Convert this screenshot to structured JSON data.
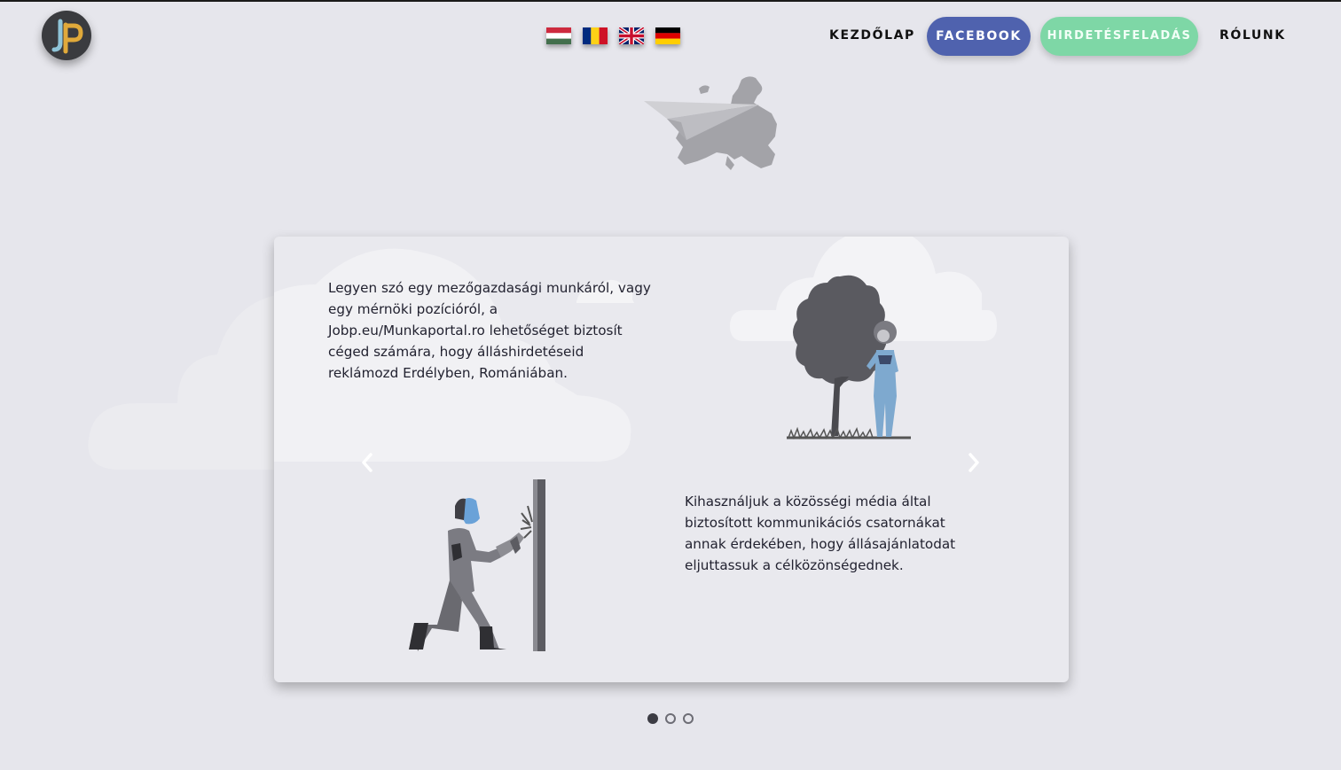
{
  "logo": {
    "letters": "JP",
    "icon": "jp-logo-icon"
  },
  "languages": [
    {
      "code": "hu",
      "icon": "flag-hungary-icon"
    },
    {
      "code": "ro",
      "icon": "flag-romania-icon"
    },
    {
      "code": "en",
      "icon": "flag-uk-icon"
    },
    {
      "code": "de",
      "icon": "flag-germany-icon"
    }
  ],
  "nav": {
    "home": "KEZDŐLAP",
    "facebook": "FACEBOOK",
    "post_ad": "HIRDETÉSFELADÁS",
    "about": "RÓLUNK"
  },
  "colors": {
    "facebook": "#4f62ae",
    "post_ad": "#7ed7a6",
    "background": "#e6e6ec"
  },
  "slider": {
    "text_top": "Legyen szó egy mezőgazdasági munkáról, vagy egy mérnöki pozícióról, a Jobp.eu/Munkaportal.ro lehetőséget biztosít céged számára, hogy álláshirdetéseid reklámozd Erdélyben, Romániában.",
    "text_bottom": "Kihasználjuk a közösségi média által biztosított kommunikációs csatornákat annak érdekében, hogy állásajánlatodat eljuttassuk a célközönségednek.",
    "prev_icon": "chevron-left-icon",
    "next_icon": "chevron-right-icon",
    "slide_count": 3,
    "active_slide": 1
  }
}
